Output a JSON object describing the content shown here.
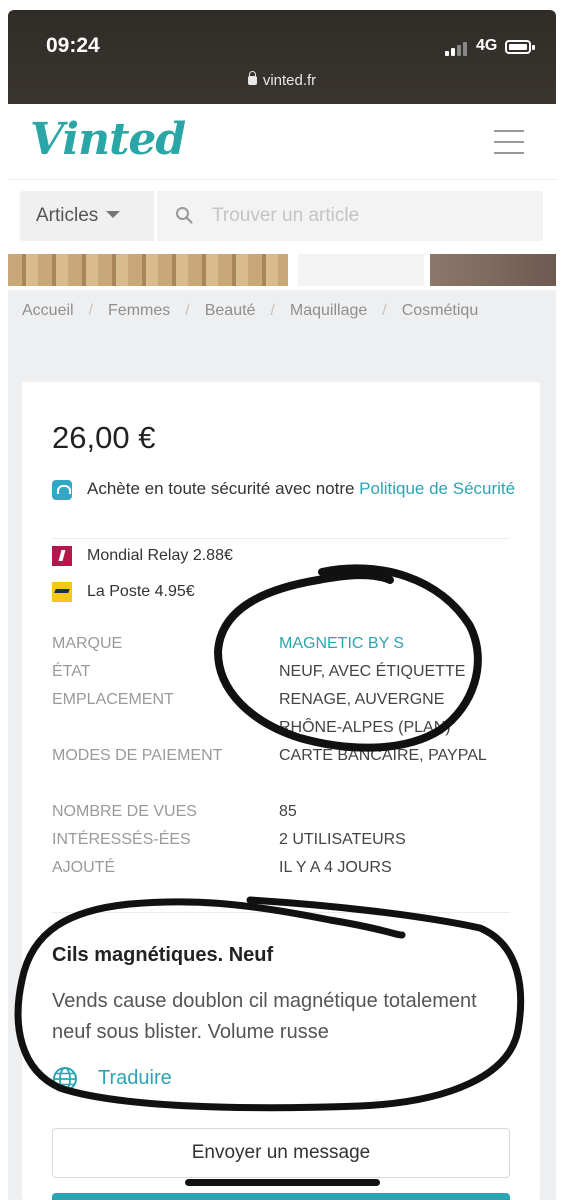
{
  "status_bar": {
    "time": "09:24",
    "network": "4G",
    "url": "vinted.fr"
  },
  "header": {
    "logo": "Vinted",
    "menu_icon": "hamburger-menu-icon"
  },
  "search": {
    "category": "Articles",
    "placeholder": "Trouver un article"
  },
  "breadcrumb": [
    "Accueil",
    "Femmes",
    "Beauté",
    "Maquillage",
    "Cosmétiqu"
  ],
  "item": {
    "price": "26,00 €",
    "secure_text": "Achète en toute sécurité avec notre ",
    "secure_link": "Politique de Sécurité",
    "shipping": [
      {
        "label": "Mondial Relay 2.88€",
        "icon": "mondial-relay-logo"
      },
      {
        "label": "La Poste 4.95€",
        "icon": "la-poste-logo"
      }
    ],
    "details": [
      {
        "key": "Marque",
        "value": "MAGNETIC BY S"
      },
      {
        "key": "État",
        "value": "NEUF, AVEC ÉTIQUETTE"
      },
      {
        "key": "Emplacement",
        "value": "RENAGE, AUVERGNE RHÔNE-ALPES (PLAN)"
      },
      {
        "key": "Modes de paiement",
        "value": "CARTE BANCAIRE, PAYPAL"
      },
      {
        "key": "Nombre de vues",
        "value": "85"
      },
      {
        "key": "Intéressés-ées",
        "value": "2 UTILISATEURS"
      },
      {
        "key": "Ajouté",
        "value": "IL Y A 4 JOURS"
      }
    ],
    "title": "Cils magnétiques. Neuf",
    "description": "Vends cause doublon cil magnétique totalement neuf sous blister. Volume russe",
    "translate_label": "Traduire",
    "message_button": "Envoyer un message"
  },
  "colors": {
    "accent": "#2ca5b2",
    "logo": "#2aa6a6",
    "mondial": "#b5174a",
    "laposte": "#f3c81a"
  }
}
